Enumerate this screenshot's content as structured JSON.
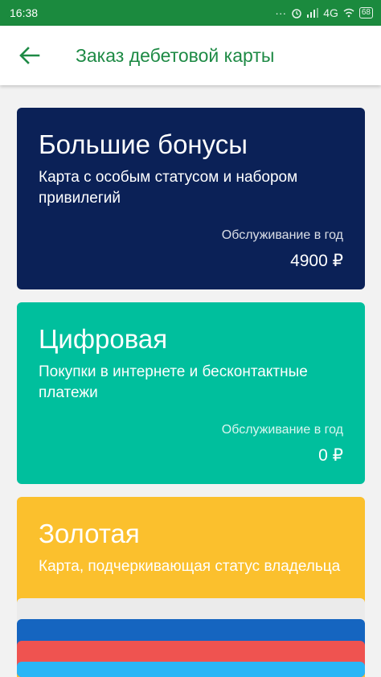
{
  "status_bar": {
    "time": "16:38",
    "network": "4G",
    "battery": "68"
  },
  "header": {
    "title": "Заказ дебетовой карты"
  },
  "cards": [
    {
      "title": "Большие бонусы",
      "description": "Карта с особым статусом и набором привилегий",
      "fee_label": "Обслуживание в год",
      "price": "4900 ₽",
      "color": "#0b2157"
    },
    {
      "title": "Цифровая",
      "description": "Покупки в интернете и бесконтактные платежи",
      "fee_label": "Обслуживание в год",
      "price": "0 ₽",
      "color": "#00bf9d"
    },
    {
      "title": "Золотая",
      "description": "Карта, подчеркивающая статус владельца",
      "color": "#fbc02d"
    }
  ],
  "stacked_cards": [
    {
      "color": "#ebebeb"
    },
    {
      "color": "#1565c0"
    },
    {
      "color": "#ef5350"
    },
    {
      "color": "#29b6f6"
    }
  ]
}
